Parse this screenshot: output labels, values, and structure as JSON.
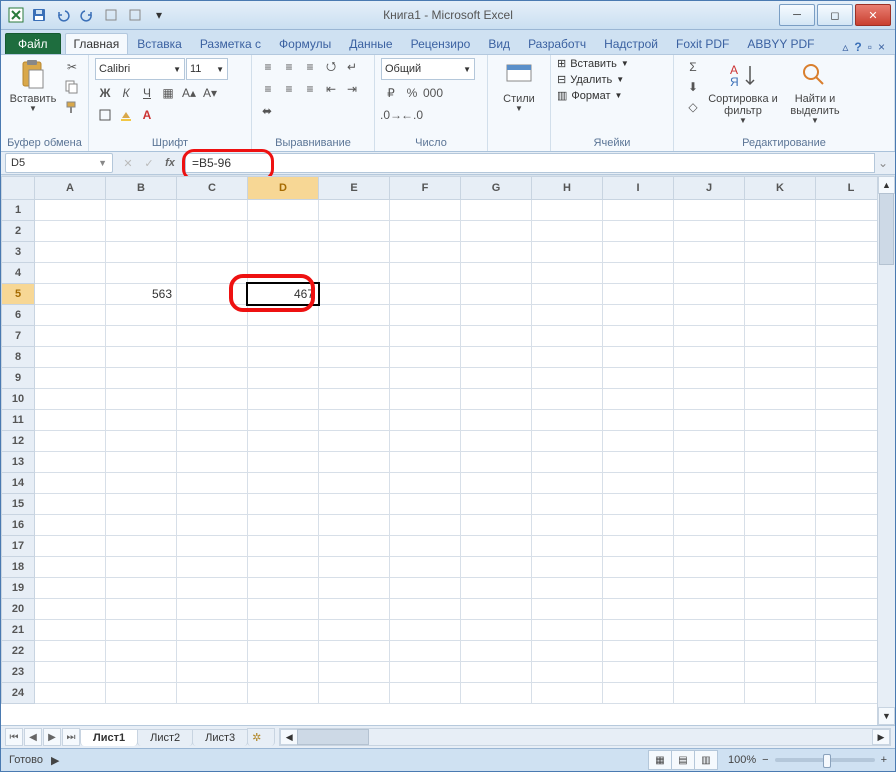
{
  "title": "Книга1 - Microsoft Excel",
  "tabs": {
    "file": "Файл",
    "items": [
      "Главная",
      "Вставка",
      "Разметка с",
      "Формулы",
      "Данные",
      "Рецензиро",
      "Вид",
      "Разработч",
      "Надстрой",
      "Foxit PDF",
      "ABBYY PDF"
    ],
    "active": 0
  },
  "ribbon": {
    "clipboard": {
      "paste": "Вставить",
      "label": "Буфер обмена"
    },
    "font": {
      "name": "Calibri",
      "size": "11",
      "label": "Шрифт",
      "bold": "Ж",
      "italic": "К",
      "underline": "Ч"
    },
    "alignment": {
      "label": "Выравнивание"
    },
    "number": {
      "format": "Общий",
      "label": "Число"
    },
    "styles": {
      "btn": "Стили"
    },
    "cells": {
      "insert": "Вставить",
      "delete": "Удалить",
      "format": "Формат",
      "label": "Ячейки"
    },
    "editing": {
      "sort": "Сортировка и фильтр",
      "find": "Найти и выделить",
      "label": "Редактирование"
    }
  },
  "formula_bar": {
    "name_box": "D5",
    "formula": "=B5-96"
  },
  "grid": {
    "columns": [
      "A",
      "B",
      "C",
      "D",
      "E",
      "F",
      "G",
      "H",
      "I",
      "J",
      "K",
      "L"
    ],
    "rows": 24,
    "selected_col": 3,
    "selected_row": 5,
    "cells": {
      "B5": "563",
      "D5": "467"
    }
  },
  "sheet_tabs": {
    "items": [
      "Лист1",
      "Лист2",
      "Лист3"
    ],
    "active": 0
  },
  "status": {
    "ready": "Готово",
    "zoom": "100%"
  }
}
